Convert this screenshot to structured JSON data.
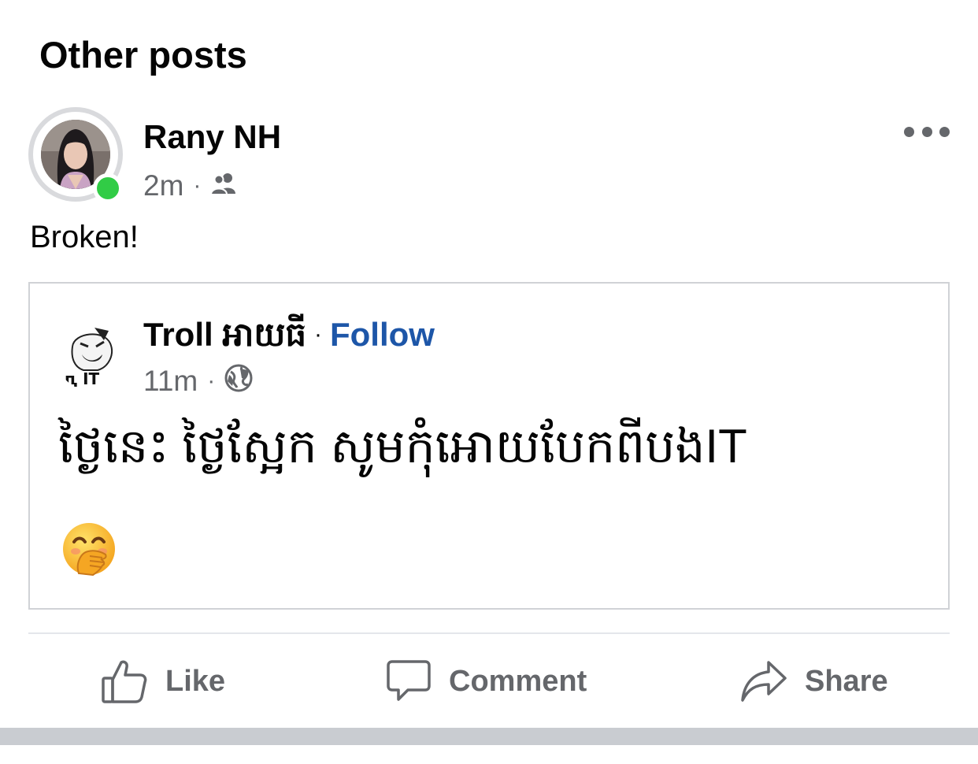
{
  "section": {
    "title": "Other posts"
  },
  "post": {
    "author": "Rany NH",
    "time": "2m",
    "separator": "·",
    "audience_icon": "friends-icon",
    "text": "Broken!"
  },
  "shared": {
    "page_name": "Troll អាយធី",
    "separator": "·",
    "follow_label": "Follow",
    "time": "11m",
    "audience_icon": "globe-icon",
    "text": "ថ្ងៃនេះ ថ្ងៃស្អែក សូមកុំអោយបែកពីបងIT",
    "emoji": "hand-over-mouth-emoji",
    "avatar_text": "ԤחIT"
  },
  "actions": {
    "like": "Like",
    "comment": "Comment",
    "share": "Share"
  },
  "colors": {
    "accent": "#1d56a8",
    "online": "#31cc46",
    "meta": "#65676b",
    "border": "#d0d2d6"
  }
}
